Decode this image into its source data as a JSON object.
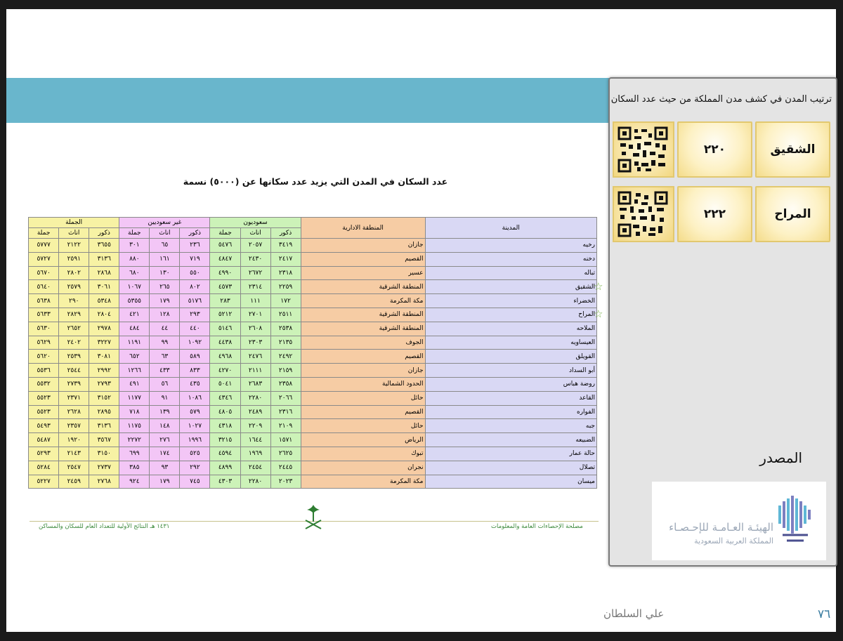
{
  "side_panel": {
    "title": "ترتيب المدن في كشف مدن المملكة من حيث عدد السكان",
    "cards": [
      {
        "city": "الشقيق",
        "rank": "٢٢٠"
      },
      {
        "city": "المراح",
        "rank": "٢٢٢"
      }
    ],
    "source_label": "المصدر",
    "logo_line1": "الهيئـة العـامـة للإحـصـاء",
    "logo_line2": "المملكة العربية السعودية"
  },
  "document": {
    "title": "عدد السكان في المدن التي يزيد عدد سكانها عن (٥٠٠٠) نسمة",
    "footer_right": "مصلحة الإحصاءات العامة والمعلومات",
    "footer_left": "١٤٣١ هـ النتائج الأولية للتعداد العام للسكان والمساكن"
  },
  "table": {
    "header": {
      "city": "المدينة",
      "region": "المنطقة الادارية",
      "saudi": "سعوديون",
      "non_saudi": "غير سعوديين",
      "total": "الجملة",
      "male": "ذكور",
      "female": "اناث",
      "sum": "جملة"
    },
    "rows": [
      {
        "city": "رخيه",
        "region": "جازان",
        "sa": [
          "٣٤١٩",
          "٢٠٥٧",
          "٥٤٧٦"
        ],
        "ns": [
          "٢٣٦",
          "٦٥",
          "٣٠١"
        ],
        "tot": [
          "٣٦٥٥",
          "٢١٢٢",
          "٥٧٧٧"
        ],
        "star": false
      },
      {
        "city": "دخنه",
        "region": "القصيم",
        "sa": [
          "٢٤١٧",
          "٢٤٣٠",
          "٤٨٤٧"
        ],
        "ns": [
          "٧١٩",
          "١٦١",
          "٨٨٠"
        ],
        "tot": [
          "٣١٣٦",
          "٢٥٩١",
          "٥٧٢٧"
        ],
        "star": false
      },
      {
        "city": "تباله",
        "region": "عسير",
        "sa": [
          "٢٣١٨",
          "٢٦٧٢",
          "٤٩٩٠"
        ],
        "ns": [
          "٥٥٠",
          "١٣٠",
          "٦٨٠"
        ],
        "tot": [
          "٢٨٦٨",
          "٢٨٠٢",
          "٥٦٧٠"
        ],
        "star": false
      },
      {
        "city": "الشقيق",
        "region": "المنطقة الشرقية",
        "sa": [
          "٢٢٥٩",
          "٢٣١٤",
          "٤٥٧٣"
        ],
        "ns": [
          "٨٠٢",
          "٢٦٥",
          "١٠٦٧"
        ],
        "tot": [
          "٣٠٦١",
          "٢٥٧٩",
          "٥٦٤٠"
        ],
        "star": true
      },
      {
        "city": "الخضراء",
        "region": "مكة المكرمة",
        "sa": [
          "١٧٢",
          "١١١",
          "٢٨٣"
        ],
        "ns": [
          "٥١٧٦",
          "١٧٩",
          "٥٣٥٥"
        ],
        "tot": [
          "٥٣٤٨",
          "٢٩٠",
          "٥٦٣٨"
        ],
        "star": false
      },
      {
        "city": "المراح",
        "region": "المنطقة الشرقية",
        "sa": [
          "٢٥١١",
          "٢٧٠١",
          "٥٢١٢"
        ],
        "ns": [
          "٢٩٣",
          "١٢٨",
          "٤٢١"
        ],
        "tot": [
          "٢٨٠٤",
          "٢٨٢٩",
          "٥٦٣٣"
        ],
        "star": true
      },
      {
        "city": "الملاحه",
        "region": "المنطقة الشرقية",
        "sa": [
          "٢٥٣٨",
          "٢٦٠٨",
          "٥١٤٦"
        ],
        "ns": [
          "٤٤٠",
          "٤٤",
          "٤٨٤"
        ],
        "tot": [
          "٢٩٧٨",
          "٢٦٥٢",
          "٥٦٣٠"
        ],
        "star": false
      },
      {
        "city": "العيساويه",
        "region": "الجوف",
        "sa": [
          "٢١٣٥",
          "٢٣٠٣",
          "٤٤٣٨"
        ],
        "ns": [
          "١٠٩٢",
          "٩٩",
          "١١٩١"
        ],
        "tot": [
          "٣٢٢٧",
          "٢٤٠٢",
          "٥٦٢٩"
        ],
        "star": false
      },
      {
        "city": "القويلق",
        "region": "القصيم",
        "sa": [
          "٢٤٩٢",
          "٢٤٧٦",
          "٤٩٦٨"
        ],
        "ns": [
          "٥٨٩",
          "٦٣",
          "٦٥٢"
        ],
        "tot": [
          "٣٠٨١",
          "٢٥٣٩",
          "٥٦٢٠"
        ],
        "star": false
      },
      {
        "city": "أبو السداد",
        "region": "جازان",
        "sa": [
          "٢١٥٩",
          "٢١١١",
          "٤٢٧٠"
        ],
        "ns": [
          "٨٣٣",
          "٤٣٣",
          "١٢٦٦"
        ],
        "tot": [
          "٢٩٩٢",
          "٢٥٤٤",
          "٥٥٣٦"
        ],
        "star": false
      },
      {
        "city": "روضة هباس",
        "region": "الحدود الشمالية",
        "sa": [
          "٢٣٥٨",
          "٢٦٨٣",
          "٥٠٤١"
        ],
        "ns": [
          "٤٣٥",
          "٥٦",
          "٤٩١"
        ],
        "tot": [
          "٢٧٩٣",
          "٢٧٣٩",
          "٥٥٣٢"
        ],
        "star": false
      },
      {
        "city": "القاعد",
        "region": "حائل",
        "sa": [
          "٢٠٦٦",
          "٢٢٨٠",
          "٤٣٤٦"
        ],
        "ns": [
          "١٠٨٦",
          "٩١",
          "١١٧٧"
        ],
        "tot": [
          "٣١٥٢",
          "٢٣٧١",
          "٥٥٢٣"
        ],
        "star": false
      },
      {
        "city": "الفواره",
        "region": "القصيم",
        "sa": [
          "٢٣١٦",
          "٢٤٨٩",
          "٤٨٠٥"
        ],
        "ns": [
          "٥٧٩",
          "١٣٩",
          "٧١٨"
        ],
        "tot": [
          "٢٨٩٥",
          "٢٦٢٨",
          "٥٥٢٣"
        ],
        "star": false
      },
      {
        "city": "جبه",
        "region": "حائل",
        "sa": [
          "٢١٠٩",
          "٢٢٠٩",
          "٤٣١٨"
        ],
        "ns": [
          "١٠٢٧",
          "١٤٨",
          "١١٧٥"
        ],
        "tot": [
          "٣١٣٦",
          "٢٣٥٧",
          "٥٤٩٣"
        ],
        "star": false
      },
      {
        "city": "الضبيعه",
        "region": "الرياض",
        "sa": [
          "١٥٧١",
          "١٦٤٤",
          "٣٢١٥"
        ],
        "ns": [
          "١٩٩٦",
          "٢٧٦",
          "٢٢٧٢"
        ],
        "tot": [
          "٣٥٦٧",
          "١٩٢٠",
          "٥٤٨٧"
        ],
        "star": false
      },
      {
        "city": "حالة عمار",
        "region": "تبوك",
        "sa": [
          "٢٦٢٥",
          "١٩٦٩",
          "٤٥٩٤"
        ],
        "ns": [
          "٥٢٥",
          "١٧٤",
          "٦٩٩"
        ],
        "tot": [
          "٣١٥٠",
          "٢١٤٣",
          "٥٢٩٣"
        ],
        "star": false
      },
      {
        "city": "تصلال",
        "region": "نجران",
        "sa": [
          "٢٤٤٥",
          "٢٤٥٤",
          "٤٨٩٩"
        ],
        "ns": [
          "٢٩٢",
          "٩٣",
          "٣٨٥"
        ],
        "tot": [
          "٢٧٣٧",
          "٢٥٤٧",
          "٥٢٨٤"
        ],
        "star": false
      },
      {
        "city": "ميسان",
        "region": "مكة المكرمة",
        "sa": [
          "٢٠٢٣",
          "٢٢٨٠",
          "٤٣٠٣"
        ],
        "ns": [
          "٧٤٥",
          "١٧٩",
          "٩٢٤"
        ],
        "tot": [
          "٢٧٦٨",
          "٢٤٥٩",
          "٥٢٢٧"
        ],
        "star": false
      }
    ]
  },
  "bottom": {
    "author": "علي السلطان",
    "page_number": "٧٦"
  },
  "colors": {
    "banner": "#69b6cc",
    "city_col": "#d9d8f4",
    "region_col": "#f6cca4",
    "saudi_col": "#ccf2b8",
    "non_saudi_col": "#f3c6f6",
    "total_col": "#f7f2a4",
    "card_border": "#e2c86f",
    "star": "#7ab34a"
  }
}
